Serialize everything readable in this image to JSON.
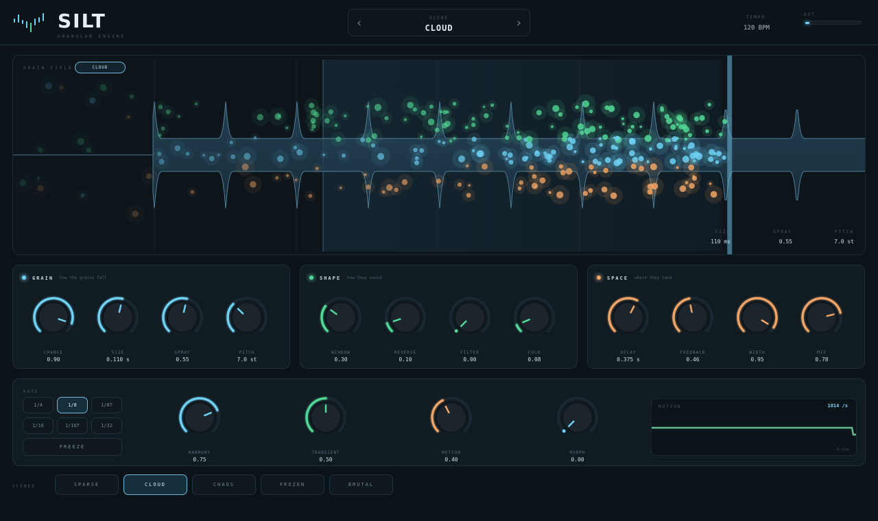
{
  "app": {
    "name": "SILT",
    "subtitle": "GRANULAR ENGINE"
  },
  "scene": {
    "label": "SCENE",
    "value": "CLOUD",
    "prev_icon": "chevron-left-icon",
    "next_icon": "chevron-right-icon"
  },
  "tempo": {
    "label": "TEMPO",
    "value": "120 BPM"
  },
  "output": {
    "label": "OUT",
    "level": 0.06
  },
  "grain_field": {
    "label": "GRAIN FIELD",
    "mode": "CLOUD",
    "playhead_fraction": 0.837,
    "readouts": [
      {
        "label": "SIZE",
        "value": "110 ms"
      },
      {
        "label": "SPRAY",
        "value": "0.55"
      },
      {
        "label": "PITCH",
        "value": "7.0 st"
      }
    ]
  },
  "panels": {
    "grain": {
      "title": "GRAIN",
      "subtitle": "how the grains fall",
      "color": "#6fd2f5",
      "knobs": [
        {
          "label": "CHANCE",
          "value": "0.90",
          "level": 0.9
        },
        {
          "label": "SIZE",
          "value": "0.110 s",
          "level": 0.55
        },
        {
          "label": "SPRAY",
          "value": "0.55",
          "level": 0.55
        },
        {
          "label": "PITCH",
          "value": "7.0 st",
          "level": 0.33
        }
      ]
    },
    "shape": {
      "title": "SHAPE",
      "subtitle": "how they sound",
      "color": "#52d896",
      "knobs": [
        {
          "label": "WINDOW",
          "value": "0.30",
          "level": 0.3
        },
        {
          "label": "REVERSE",
          "value": "0.10",
          "level": 0.1
        },
        {
          "label": "FILTER",
          "value": "0.00",
          "level": 0.0
        },
        {
          "label": "FOLD",
          "value": "0.08",
          "level": 0.08
        }
      ]
    },
    "space": {
      "title": "SPACE",
      "subtitle": "where they land",
      "color": "#f0a566",
      "knobs": [
        {
          "label": "DELAY",
          "value": "0.375 s",
          "level": 0.6
        },
        {
          "label": "FEEDBACK",
          "value": "0.46",
          "level": 0.46
        },
        {
          "label": "WIDTH",
          "value": "0.95",
          "level": 0.95
        },
        {
          "label": "MIX",
          "value": "0.78",
          "level": 0.78
        }
      ]
    }
  },
  "rate": {
    "label": "RATE",
    "options": [
      "1/4",
      "1/8",
      "1/8T",
      "1/16",
      "1/16T",
      "1/32"
    ],
    "selected": "1/8",
    "freeze_label": "FREEZE"
  },
  "macros": [
    {
      "label": "HARMONY",
      "value": "0.75",
      "level": 0.75,
      "color": "#6fd2f5"
    },
    {
      "label": "TRANSIENT",
      "value": "0.50",
      "level": 0.5,
      "color": "#52d896"
    },
    {
      "label": "MOTION",
      "value": "0.40",
      "level": 0.4,
      "color": "#f0a566"
    },
    {
      "label": "MORPH",
      "value": "0.00",
      "level": 0.0,
      "color": "#6fd2f5"
    }
  ],
  "motion": {
    "label": "MOTION",
    "rate": "1014 /s",
    "time": "6 live"
  },
  "scenes": {
    "label": "SCENES",
    "items": [
      "SPARSE",
      "CLOUD",
      "CHAOS",
      "FROZEN",
      "BRUTAL"
    ],
    "selected": "CLOUD"
  }
}
